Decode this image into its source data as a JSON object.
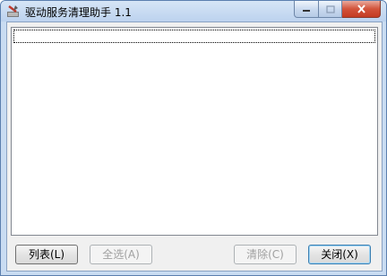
{
  "window": {
    "title": "驱动服务清理助手 1.1",
    "icon": "tools-app-icon"
  },
  "buttons": {
    "list": "列表(L)",
    "select_all": "全选(A)",
    "clear": "清除(C)",
    "close": "关闭(X)"
  },
  "colors": {
    "titlebar": "#c9dcf2",
    "close_button": "#c43b22",
    "client": "#f0f0f0"
  }
}
